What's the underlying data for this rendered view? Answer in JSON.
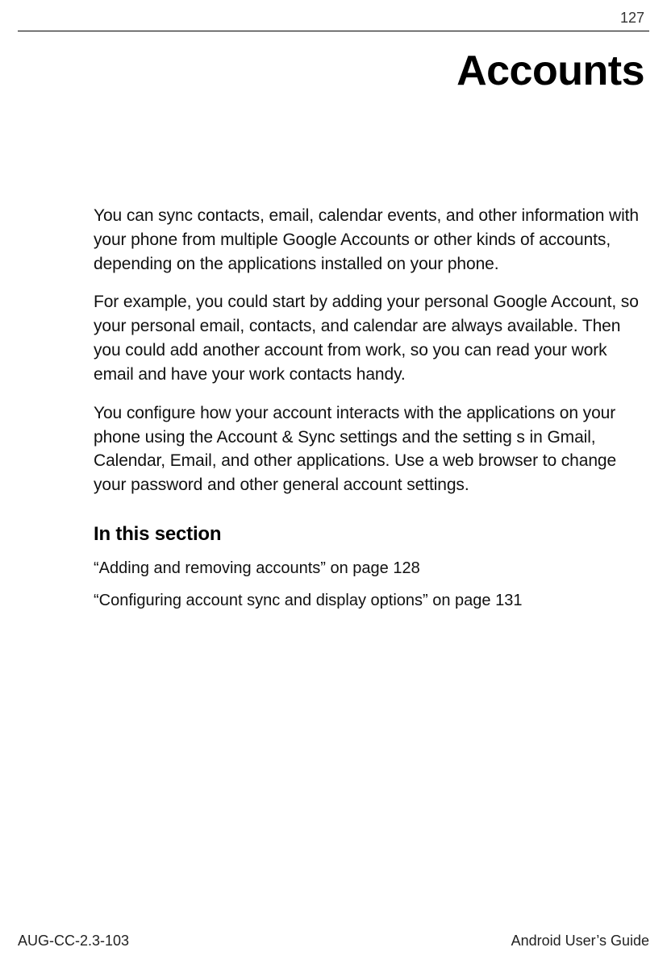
{
  "page_number": "127",
  "chapter_title": "Accounts",
  "paragraphs": [
    "You can sync contacts, email, calendar events, and other information with your phone from multiple Google Accounts or other kinds of accounts, depending on the applications installed on your phone.",
    "For example, you could start by adding your personal Google Account, so your personal email, contacts, and calendar are always available. Then you could add another account from work, so you can read your work email and have your work contacts handy.",
    "You configure how your account interacts with the applications on your phone using the Account & Sync settings and the setting s in Gmail, Calendar, Email, and other applications. Use a web browser to change your password and other general account settings."
  ],
  "section_heading": "In this section",
  "toc_links": [
    "“Adding and removing accounts” on page 128",
    "“Configuring account sync and display options” on page 131"
  ],
  "footer": {
    "left": "AUG-CC-2.3-103",
    "right": "Android User’s Guide"
  }
}
